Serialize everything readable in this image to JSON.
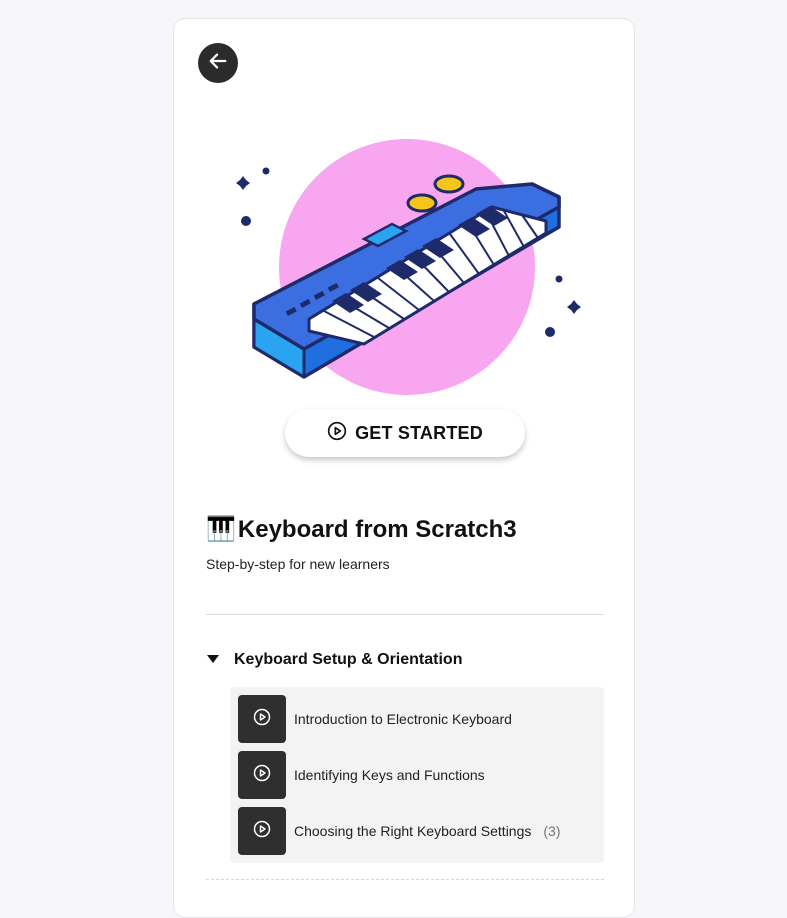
{
  "header": {
    "back_icon": "arrow-left-icon"
  },
  "hero": {
    "illustration": "electronic-keyboard-illustration",
    "circle_color": "#f8a6ef",
    "keyboard_color": "#3b6ee0"
  },
  "cta": {
    "icon": "play-circle-icon",
    "label": "GET STARTED"
  },
  "course": {
    "emoji": "🎹",
    "title": "Keyboard from Scratch3",
    "subtitle": "Step-by-step for new learners"
  },
  "section": {
    "toggle_icon": "caret-down-icon",
    "title": "Keyboard Setup & Orientation",
    "lessons": [
      {
        "icon": "play-circle-icon",
        "label": "Introduction to Electronic Keyboard",
        "count": ""
      },
      {
        "icon": "play-circle-icon",
        "label": "Identifying Keys and Functions",
        "count": ""
      },
      {
        "icon": "play-circle-icon",
        "label": "Choosing the Right Keyboard Settings",
        "count": "(3)"
      }
    ]
  }
}
